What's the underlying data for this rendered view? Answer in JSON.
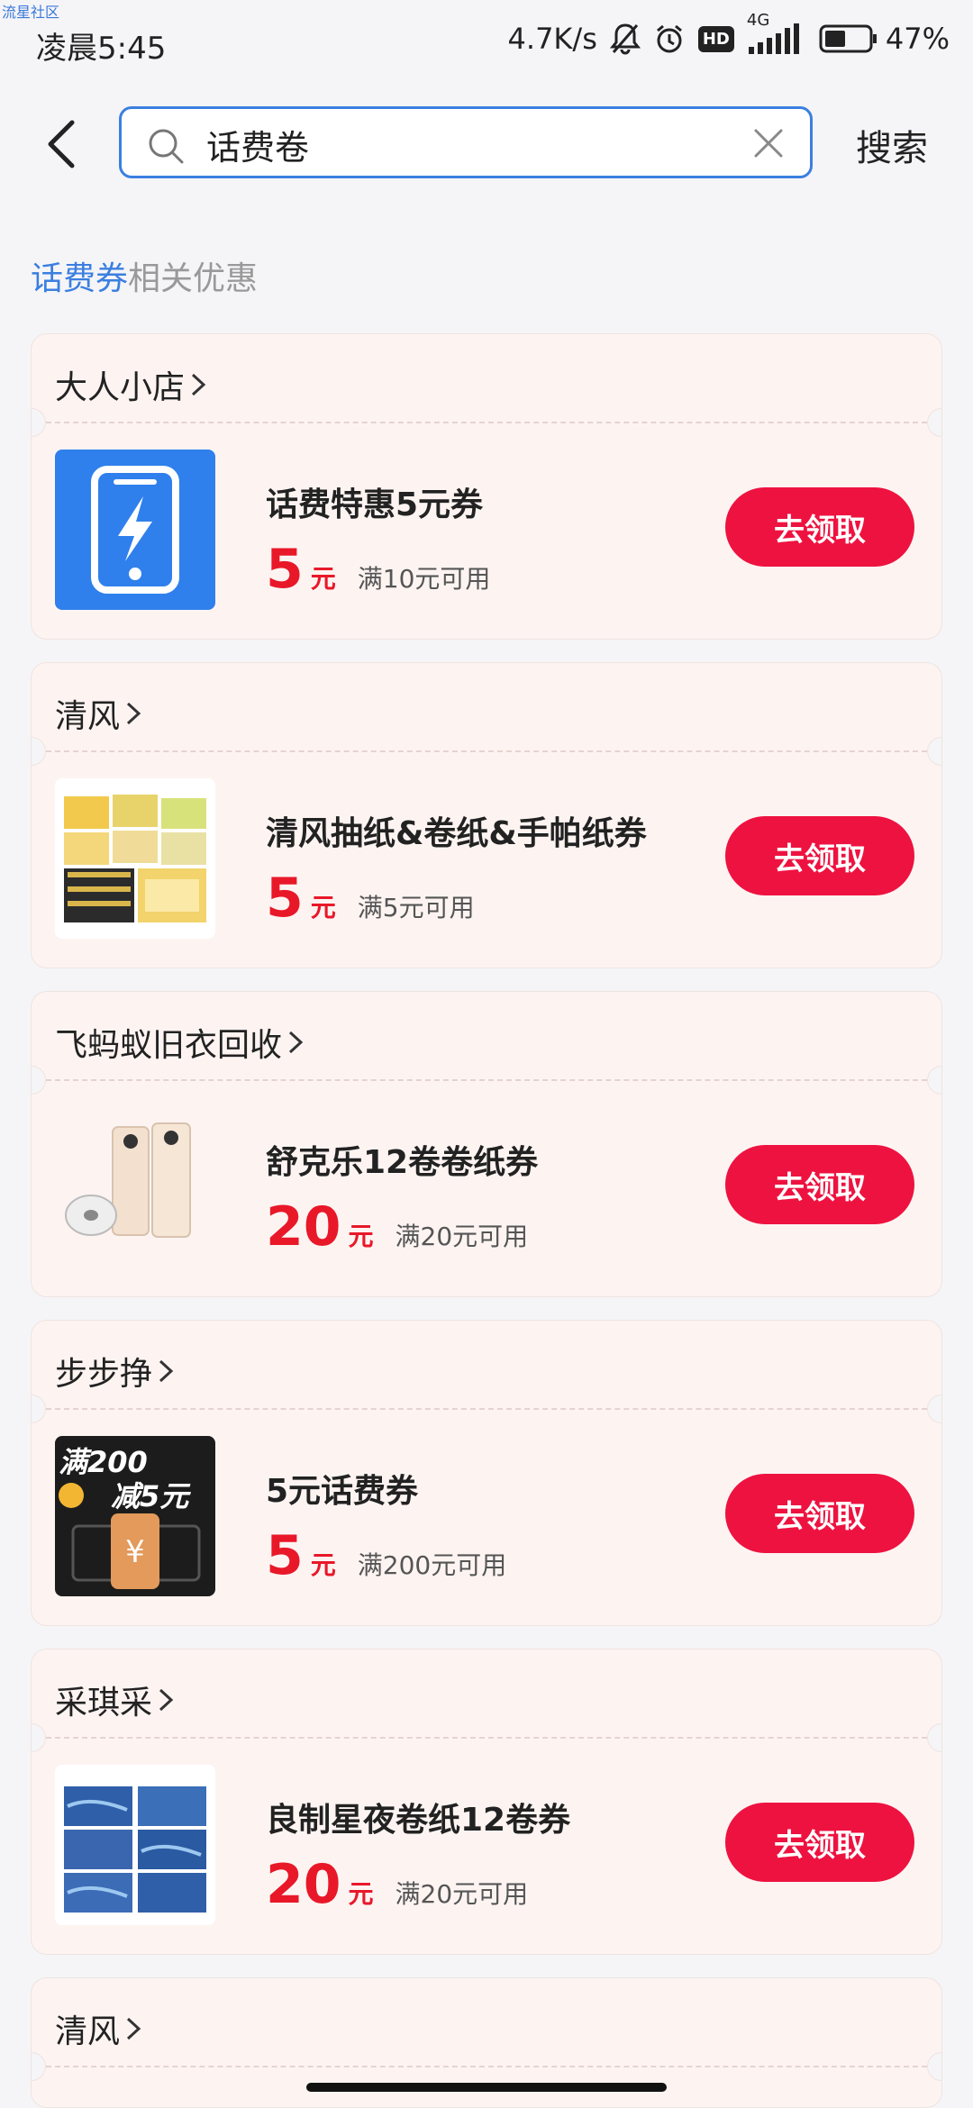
{
  "watermark": "流星社区",
  "status": {
    "time": "凌晨5:45",
    "speed": "4.7K/s",
    "hd": "HD",
    "network": "4G",
    "battery": "47%"
  },
  "search": {
    "value": "话费卷",
    "button": "搜索"
  },
  "section": {
    "keyword": "话费券",
    "suffix": "相关优惠"
  },
  "coupons": [
    {
      "shop": "大人小店",
      "title": "话费特惠5元券",
      "amount": "5",
      "unit": "元",
      "condition": "满10元可用",
      "button": "去领取",
      "thumb": "phone-charge-icon"
    },
    {
      "shop": "清风",
      "title": "清风抽纸&卷纸&手帕纸券",
      "amount": "5",
      "unit": "元",
      "condition": "满5元可用",
      "button": "去领取",
      "thumb": "tissue-boxes-image"
    },
    {
      "shop": "飞蚂蚁旧衣回收",
      "title": "舒克乐12卷卷纸券",
      "amount": "20",
      "unit": "元",
      "condition": "满20元可用",
      "button": "去领取",
      "thumb": "toilet-roll-image"
    },
    {
      "shop": "步步挣",
      "title": "5元话费券",
      "amount": "5",
      "unit": "元",
      "condition": "满200元可用",
      "button": "去领取",
      "thumb": "promo-coupon-image",
      "thumb_text": [
        "满200",
        "减5元"
      ]
    },
    {
      "shop": "采琪采",
      "title": "良制星夜卷纸12卷券",
      "amount": "20",
      "unit": "元",
      "condition": "满20元可用",
      "button": "去领取",
      "thumb": "starry-tissue-image"
    },
    {
      "shop": "清风"
    }
  ],
  "colors": {
    "accent": "#3b7fe0",
    "price": "#e81829",
    "button": "#ee1240",
    "card": "#fdf4f2"
  }
}
